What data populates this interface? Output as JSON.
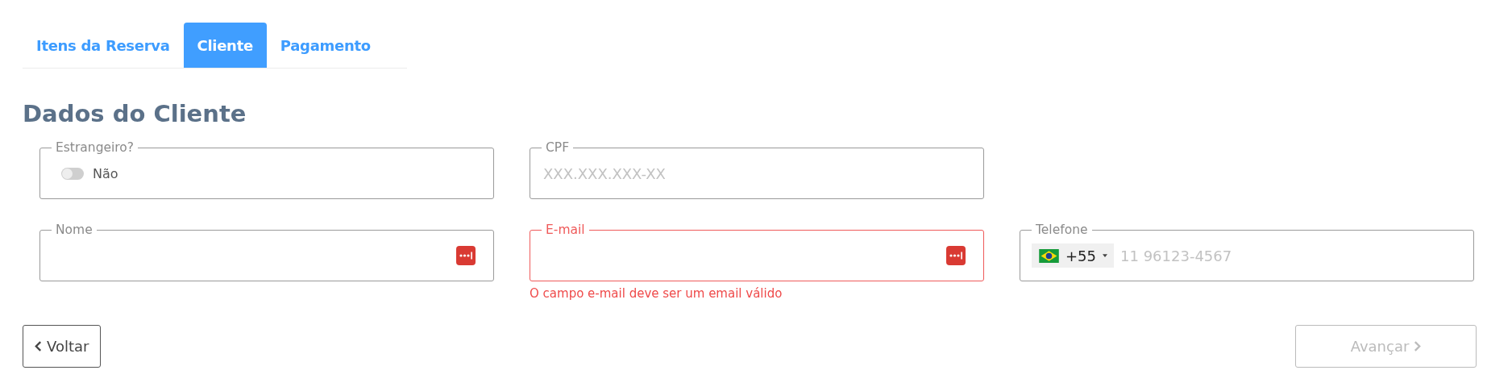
{
  "tabs": [
    {
      "label": "Itens da Reserva",
      "selected": false
    },
    {
      "label": "Cliente",
      "selected": true
    },
    {
      "label": "Pagamento",
      "selected": false
    }
  ],
  "heading": "Dados do Cliente",
  "rows": [
    [
      {
        "kind": "toggle",
        "label": "Estrangeiro?",
        "on": false,
        "value": "Não"
      },
      {
        "kind": "text",
        "label": "CPF",
        "placeholder": "XXX.XXX.XXX-XX",
        "invalid": false,
        "autofill": false
      }
    ],
    [
      {
        "kind": "text",
        "label": "Nome",
        "invalid": false,
        "autofill": true
      },
      {
        "kind": "text",
        "label": "E-mail",
        "invalid": true,
        "autofill": true,
        "error_message": "O campo e-mail deve ser um email válido"
      },
      {
        "kind": "phone",
        "label": "Telefone",
        "country_code": "+55",
        "placeholder": "11 96123-4567"
      }
    ]
  ],
  "back_button": {
    "label": "Voltar",
    "disabled": false
  },
  "next_button": {
    "label": "Avançar",
    "disabled": true
  }
}
